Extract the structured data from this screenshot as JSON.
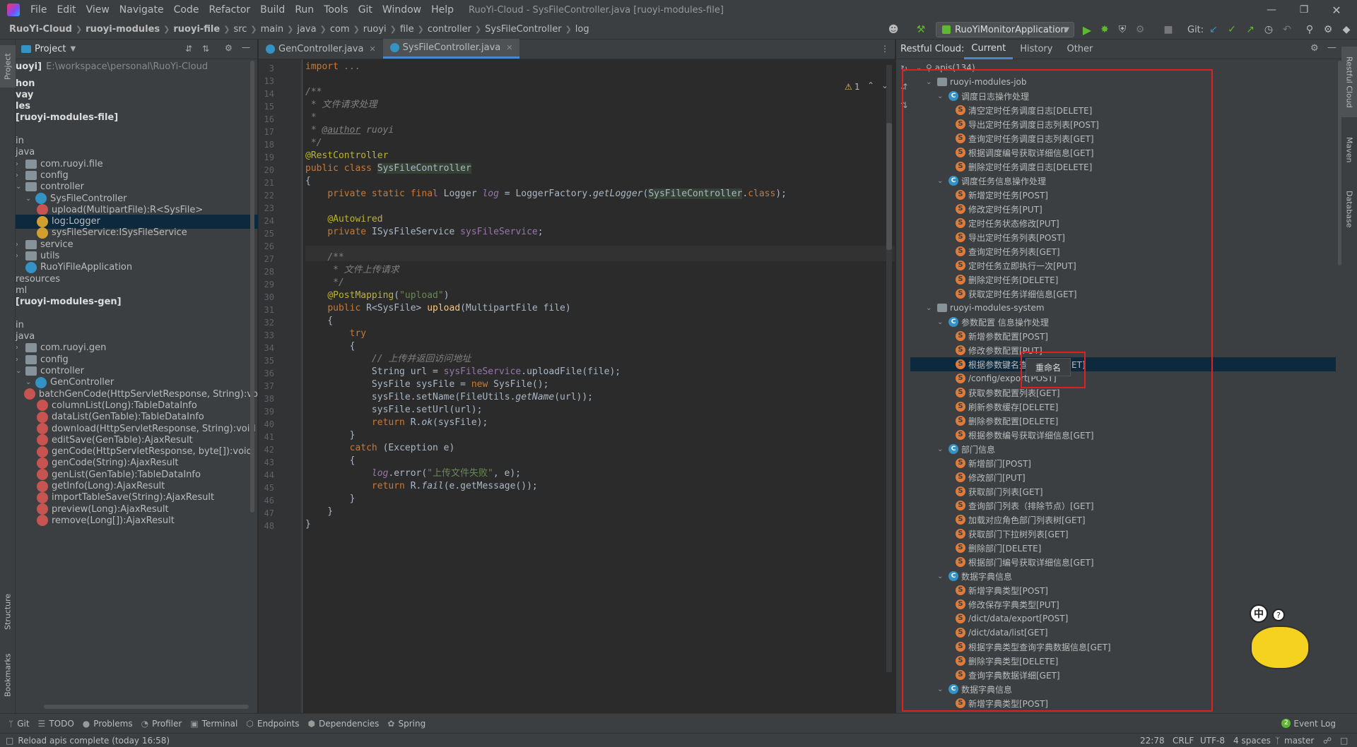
{
  "menubar": {
    "items": [
      "File",
      "Edit",
      "View",
      "Navigate",
      "Code",
      "Refactor",
      "Build",
      "Run",
      "Tools",
      "Git",
      "Window",
      "Help"
    ],
    "title": "RuoYi-Cloud - SysFileController.java [ruoyi-modules-file]"
  },
  "breadcrumb": [
    "RuoYi-Cloud",
    "ruoyi-modules",
    "ruoyi-file",
    "src",
    "main",
    "java",
    "com",
    "ruoyi",
    "file",
    "controller",
    "SysFileController",
    "log"
  ],
  "toolbar": {
    "run_config": "RuoYiMonitorApplication",
    "git_label": "Git:"
  },
  "project": {
    "title": "Project",
    "root": {
      "name": "uoyi]",
      "path": "E:\\workspace\\personal\\RuoYi-Cloud"
    },
    "rows": [
      {
        "label": "hon",
        "x": 0,
        "kind": "text"
      },
      {
        "label": "vay",
        "x": 0,
        "kind": "text"
      },
      {
        "label": "les",
        "x": 0,
        "kind": "text"
      },
      {
        "label": "[ruoyi-modules-file]",
        "x": 0,
        "kind": "text"
      },
      {
        "label": "",
        "x": 0,
        "kind": "blank"
      },
      {
        "label": "in",
        "x": 0,
        "kind": "text"
      },
      {
        "label": "java",
        "x": 0,
        "kind": "text"
      },
      {
        "label": "com.ruoyi.file",
        "x": 1,
        "kind": "pkg"
      },
      {
        "label": "config",
        "x": 1,
        "kind": "folder"
      },
      {
        "label": "controller",
        "x": 1,
        "kind": "folder"
      },
      {
        "label": "SysFileController",
        "x": 2,
        "kind": "class"
      },
      {
        "label": "upload(MultipartFile):R<SysFile>",
        "x": 3,
        "kind": "method"
      },
      {
        "label": "log:Logger",
        "x": 3,
        "kind": "field"
      },
      {
        "label": "sysFileService:ISysFileService",
        "x": 3,
        "kind": "field2"
      },
      {
        "label": "service",
        "x": 1,
        "kind": "folder"
      },
      {
        "label": "utils",
        "x": 1,
        "kind": "folder"
      },
      {
        "label": "RuoYiFileApplication",
        "x": 1,
        "kind": "class"
      },
      {
        "label": "resources",
        "x": 0,
        "kind": "text"
      },
      {
        "label": "ml",
        "x": 0,
        "kind": "text"
      },
      {
        "label": "[ruoyi-modules-gen]",
        "x": 0,
        "kind": "text"
      },
      {
        "label": "",
        "x": 0,
        "kind": "blank"
      },
      {
        "label": "in",
        "x": 0,
        "kind": "text"
      },
      {
        "label": "java",
        "x": 0,
        "kind": "text"
      },
      {
        "label": "com.ruoyi.gen",
        "x": 1,
        "kind": "pkg"
      },
      {
        "label": "config",
        "x": 1,
        "kind": "folder"
      },
      {
        "label": "controller",
        "x": 1,
        "kind": "folder"
      },
      {
        "label": "GenController",
        "x": 2,
        "kind": "class"
      },
      {
        "label": "batchGenCode(HttpServletResponse, String):vo",
        "x": 3,
        "kind": "method"
      },
      {
        "label": "columnList(Long):TableDataInfo",
        "x": 3,
        "kind": "method"
      },
      {
        "label": "dataList(GenTable):TableDataInfo",
        "x": 3,
        "kind": "method"
      },
      {
        "label": "download(HttpServletResponse, String):void",
        "x": 3,
        "kind": "method"
      },
      {
        "label": "editSave(GenTable):AjaxResult",
        "x": 3,
        "kind": "method"
      },
      {
        "label": "genCode(HttpServletResponse, byte[]):void",
        "x": 3,
        "kind": "method"
      },
      {
        "label": "genCode(String):AjaxResult",
        "x": 3,
        "kind": "method"
      },
      {
        "label": "genList(GenTable):TableDataInfo",
        "x": 3,
        "kind": "method"
      },
      {
        "label": "getInfo(Long):AjaxResult",
        "x": 3,
        "kind": "method"
      },
      {
        "label": "importTableSave(String):AjaxResult",
        "x": 3,
        "kind": "method"
      },
      {
        "label": "preview(Long):AjaxResult",
        "x": 3,
        "kind": "method"
      },
      {
        "label": "remove(Long[]):AjaxResult",
        "x": 3,
        "kind": "method"
      }
    ]
  },
  "editor": {
    "tabs": [
      "GenController.java",
      "SysFileController.java"
    ],
    "inspection": "1",
    "line_numbers": [
      "3",
      "13",
      "14",
      "15",
      "16",
      "17",
      "18",
      "19",
      "20",
      "21",
      "22",
      "23",
      "24",
      "25",
      "26",
      "27",
      "28",
      "29",
      "30",
      "31",
      "32",
      "33",
      "34",
      "35",
      "36",
      "37",
      "38",
      "39",
      "40",
      "41",
      "42",
      "43",
      "44",
      "45",
      "46",
      "47",
      "48"
    ],
    "code": [
      "<span class=\"kw\">import</span> <span class=\"cm\">...</span>",
      "",
      "<span class=\"cm\">/**</span>",
      "<span class=\"cm\"> * 文件请求处理</span>",
      "<span class=\"cm\"> *</span>",
      "<span class=\"cm\"> * <u>@author</u> ruoyi</span>",
      "<span class=\"cm\"> */</span>",
      "<span class=\"an\">@RestController</span>",
      "<span class=\"kw\">public class</span> <span style=\"background:#344134\">SysFileController</span>",
      "{",
      "    <span class=\"kw\">private static final</span> Logger <span class=\"fld it\">log</span> = LoggerFactory.<span class=\"it\">getLogger</span>(<span style=\"background:#344134\">SysFileController</span>.<span class=\"kw\">class</span>);",
      "",
      "    <span class=\"an\">@Autowired</span>",
      "    <span class=\"kw\">private</span> ISysFileService <span class=\"fld\">sysFileService</span>;",
      "",
      "    <span class=\"cm\">/**</span>",
      "<span class=\"cm\">     * 文件上传请求</span>",
      "<span class=\"cm\">     */</span>",
      "    <span class=\"an\">@PostMapping</span>(<span class=\"str\">\"upload\"</span>)",
      "    <span class=\"kw\">public</span> R&lt;SysFile&gt; <span style=\"color:#ffc66d\">upload</span>(MultipartFile file)",
      "    {",
      "        <span class=\"kw\">try</span>",
      "        {",
      "            <span class=\"cm\">// 上传并返回访问地址</span>",
      "            String url = <span class=\"fld\">sysFileService</span>.uploadFile(file);",
      "            SysFile sysFile = <span class=\"kw\">new</span> SysFile();",
      "            sysFile.setName(FileUtils.<span class=\"it\">getName</span>(url));",
      "            sysFile.setUrl(url);",
      "            <span class=\"kw\">return</span> R.<span class=\"it\">ok</span>(sysFile);",
      "        }",
      "        <span class=\"kw\">catch</span> (Exception e)",
      "        {",
      "            <span class=\"fld it\">log</span>.error(<span class=\"str\">\"上传文件失败\"</span>, e);",
      "            <span class=\"kw\">return</span> R.<span class=\"it\">fail</span>(e.getMessage());",
      "        }",
      "    }",
      "}"
    ]
  },
  "restful": {
    "title": "Restful Cloud:",
    "tabs": [
      "Current",
      "History",
      "Other"
    ],
    "root": "apis(134)",
    "context_menu": "重命名",
    "rows": [
      {
        "label": "ruoyi-modules-job",
        "lvl": 0,
        "kind": "module"
      },
      {
        "label": "调度日志操作处理",
        "lvl": 1,
        "kind": "ctrl"
      },
      {
        "label": "清空定时任务调度日志[DELETE]",
        "lvl": 2,
        "kind": "api"
      },
      {
        "label": "导出定时任务调度日志列表[POST]",
        "lvl": 2,
        "kind": "api"
      },
      {
        "label": "查询定时任务调度日志列表[GET]",
        "lvl": 2,
        "kind": "api"
      },
      {
        "label": "根据调度编号获取详细信息[GET]",
        "lvl": 2,
        "kind": "api"
      },
      {
        "label": "删除定时任务调度日志[DELETE]",
        "lvl": 2,
        "kind": "api"
      },
      {
        "label": "调度任务信息操作处理",
        "lvl": 1,
        "kind": "ctrl"
      },
      {
        "label": "新增定时任务[POST]",
        "lvl": 2,
        "kind": "api"
      },
      {
        "label": "修改定时任务[PUT]",
        "lvl": 2,
        "kind": "api"
      },
      {
        "label": "定时任务状态修改[PUT]",
        "lvl": 2,
        "kind": "api"
      },
      {
        "label": "导出定时任务列表[POST]",
        "lvl": 2,
        "kind": "api"
      },
      {
        "label": "查询定时任务列表[GET]",
        "lvl": 2,
        "kind": "api"
      },
      {
        "label": "定时任务立即执行一次[PUT]",
        "lvl": 2,
        "kind": "api"
      },
      {
        "label": "删除定时任务[DELETE]",
        "lvl": 2,
        "kind": "api"
      },
      {
        "label": "获取定时任务详细信息[GET]",
        "lvl": 2,
        "kind": "api"
      },
      {
        "label": "ruoyi-modules-system",
        "lvl": 0,
        "kind": "module"
      },
      {
        "label": "参数配置 信息操作处理",
        "lvl": 1,
        "kind": "ctrl"
      },
      {
        "label": "新增参数配置[POST]",
        "lvl": 2,
        "kind": "api"
      },
      {
        "label": "修改参数配置[PUT]",
        "lvl": 2,
        "kind": "api"
      },
      {
        "label": "根据参数键名查询参数值[GET]",
        "lvl": 2,
        "kind": "api"
      },
      {
        "label": "/config/export[POST]",
        "lvl": 2,
        "kind": "api"
      },
      {
        "label": "获取参数配置列表[GET]",
        "lvl": 2,
        "kind": "api"
      },
      {
        "label": "刷新参数缓存[DELETE]",
        "lvl": 2,
        "kind": "api"
      },
      {
        "label": "删除参数配置[DELETE]",
        "lvl": 2,
        "kind": "api"
      },
      {
        "label": "根据参数编号获取详细信息[GET]",
        "lvl": 2,
        "kind": "api"
      },
      {
        "label": "部门信息",
        "lvl": 1,
        "kind": "ctrl"
      },
      {
        "label": "新增部门[POST]",
        "lvl": 2,
        "kind": "api"
      },
      {
        "label": "修改部门[PUT]",
        "lvl": 2,
        "kind": "api"
      },
      {
        "label": "获取部门列表[GET]",
        "lvl": 2,
        "kind": "api"
      },
      {
        "label": "查询部门列表（排除节点）[GET]",
        "lvl": 2,
        "kind": "api"
      },
      {
        "label": "加载对应角色部门列表树[GET]",
        "lvl": 2,
        "kind": "api"
      },
      {
        "label": "获取部门下拉树列表[GET]",
        "lvl": 2,
        "kind": "api"
      },
      {
        "label": "删除部门[DELETE]",
        "lvl": 2,
        "kind": "api"
      },
      {
        "label": "根据部门编号获取详细信息[GET]",
        "lvl": 2,
        "kind": "api"
      },
      {
        "label": "数据字典信息",
        "lvl": 1,
        "kind": "ctrl"
      },
      {
        "label": "新增字典类型[POST]",
        "lvl": 2,
        "kind": "api"
      },
      {
        "label": "修改保存字典类型[PUT]",
        "lvl": 2,
        "kind": "api"
      },
      {
        "label": "/dict/data/export[POST]",
        "lvl": 2,
        "kind": "api"
      },
      {
        "label": "/dict/data/list[GET]",
        "lvl": 2,
        "kind": "api"
      },
      {
        "label": "根据字典类型查询字典数据信息[GET]",
        "lvl": 2,
        "kind": "api"
      },
      {
        "label": "删除字典类型[DELETE]",
        "lvl": 2,
        "kind": "api"
      },
      {
        "label": "查询字典数据详细[GET]",
        "lvl": 2,
        "kind": "api"
      },
      {
        "label": "数据字典信息",
        "lvl": 1,
        "kind": "ctrl"
      },
      {
        "label": "新增字典类型[POST]",
        "lvl": 2,
        "kind": "api"
      }
    ]
  },
  "right_strip": [
    "Restful Cloud",
    "Maven",
    "Database"
  ],
  "left_strip": [
    "Project",
    "Structure",
    "Bookmarks"
  ],
  "bottom_tools": [
    "Git",
    "TODO",
    "Problems",
    "Profiler",
    "Terminal",
    "Endpoints",
    "Dependencies",
    "Spring"
  ],
  "event_log": "Event Log",
  "event_count": "2",
  "status": {
    "message": "Reload apis complete (today 16:58)",
    "position": "22:78",
    "line_sep": "CRLF",
    "encoding": "UTF-8",
    "indent": "4 spaces",
    "branch": "master"
  },
  "ime": {
    "label": "中"
  },
  "colors": {
    "accent": "#4a88c7",
    "highlight_box": "#e02020",
    "selection": "#0d293e"
  }
}
